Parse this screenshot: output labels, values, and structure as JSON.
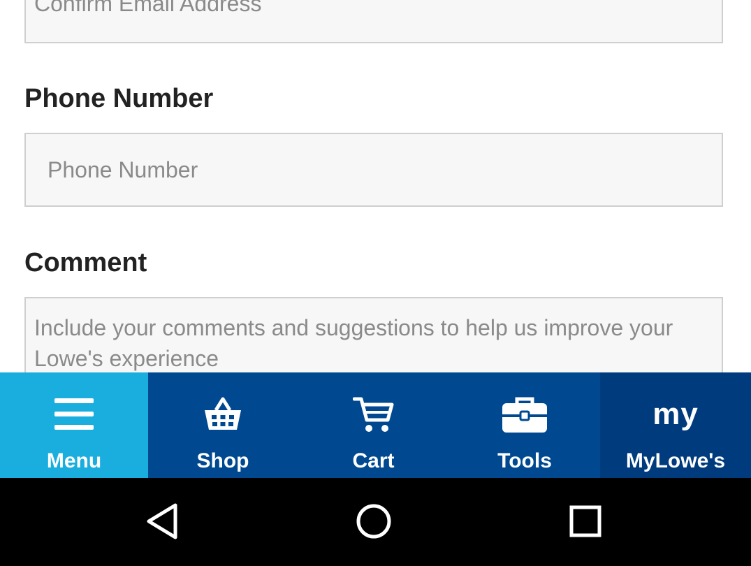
{
  "form": {
    "confirm_email_placeholder": "Confirm Email Address",
    "phone_label": "Phone Number",
    "phone_placeholder": "Phone Number",
    "comment_label": "Comment",
    "comment_placeholder": "Include your comments and suggestions to help us improve your Lowe's experience"
  },
  "bottom_nav": {
    "items": [
      {
        "label": "Menu",
        "icon": "hamburger-icon",
        "active": true
      },
      {
        "label": "Shop",
        "icon": "basket-icon"
      },
      {
        "label": "Cart",
        "icon": "cart-icon"
      },
      {
        "label": "Tools",
        "icon": "toolbox-icon"
      },
      {
        "label": "MyLowe's",
        "icon": "my-icon",
        "icon_text": "my"
      }
    ]
  },
  "colors": {
    "nav_bg": "#004990",
    "nav_active": "#1aaedf",
    "nav_mylowes": "#003b7e",
    "system_bar": "#000000"
  }
}
